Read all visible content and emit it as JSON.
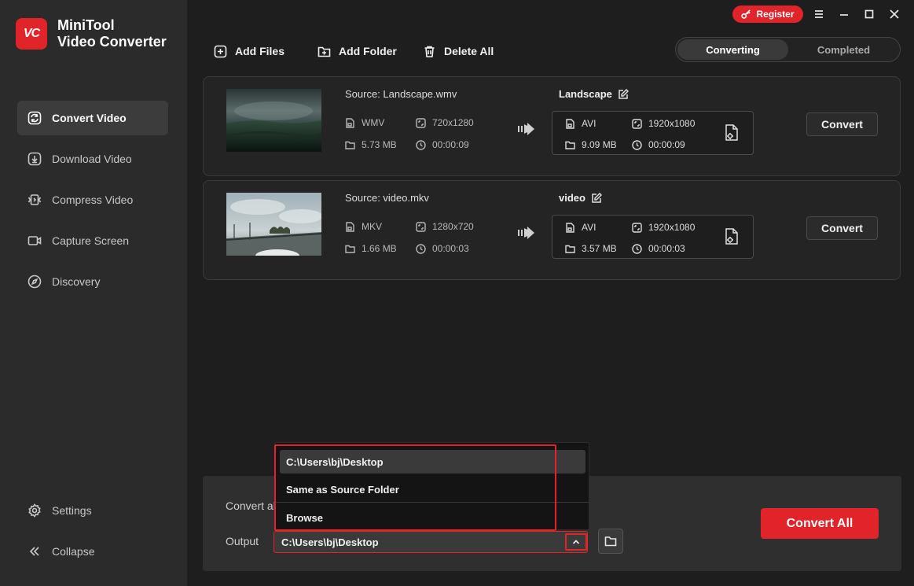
{
  "app": {
    "name_line1": "MiniTool",
    "name_line2": "Video Converter",
    "logo_mark": "VC"
  },
  "topbar": {
    "register_label": "Register"
  },
  "sidebar": {
    "items": [
      {
        "label": "Convert Video",
        "icon": "convert-icon",
        "active": true
      },
      {
        "label": "Download Video",
        "icon": "download-icon"
      },
      {
        "label": "Compress Video",
        "icon": "compress-icon"
      },
      {
        "label": "Capture Screen",
        "icon": "camera-icon"
      },
      {
        "label": "Discovery",
        "icon": "compass-icon"
      }
    ],
    "settings_label": "Settings",
    "collapse_label": "Collapse"
  },
  "toolbar": {
    "add_files": "Add Files",
    "add_folder": "Add Folder",
    "delete_all": "Delete All"
  },
  "tabs": {
    "converting": "Converting",
    "completed": "Completed",
    "active": "Converting"
  },
  "files": [
    {
      "source": "Source:  Landscape.wmv",
      "src_format": "WMV",
      "src_resolution": "720x1280",
      "src_size": "5.73 MB",
      "src_duration": "00:00:09",
      "target_name": "Landscape",
      "tgt_format": "AVI",
      "tgt_resolution": "1920x1080",
      "tgt_size": "9.09 MB",
      "tgt_duration": "00:00:09",
      "convert_label": "Convert"
    },
    {
      "source": "Source:  video.mkv",
      "src_format": "MKV",
      "src_resolution": "1280x720",
      "src_size": "1.66 MB",
      "src_duration": "00:00:03",
      "target_name": "video",
      "tgt_format": "AVI",
      "tgt_resolution": "1920x1080",
      "tgt_size": "3.57 MB",
      "tgt_duration": "00:00:03",
      "convert_label": "Convert"
    }
  ],
  "bottom": {
    "convert_all_to_label": "Convert al",
    "output_label": "Output",
    "output_value": "C:\\Users\\bj\\Desktop",
    "convert_all_button": "Convert All"
  },
  "output_dropdown": {
    "options": [
      "C:\\Users\\bj\\Desktop",
      "Same as Source Folder",
      "Browse"
    ],
    "selected": "C:\\Users\\bj\\Desktop"
  },
  "colors": {
    "accent": "#e0242a",
    "sidebar_bg": "#2b2b2b",
    "main_bg": "#1e1e1e"
  }
}
